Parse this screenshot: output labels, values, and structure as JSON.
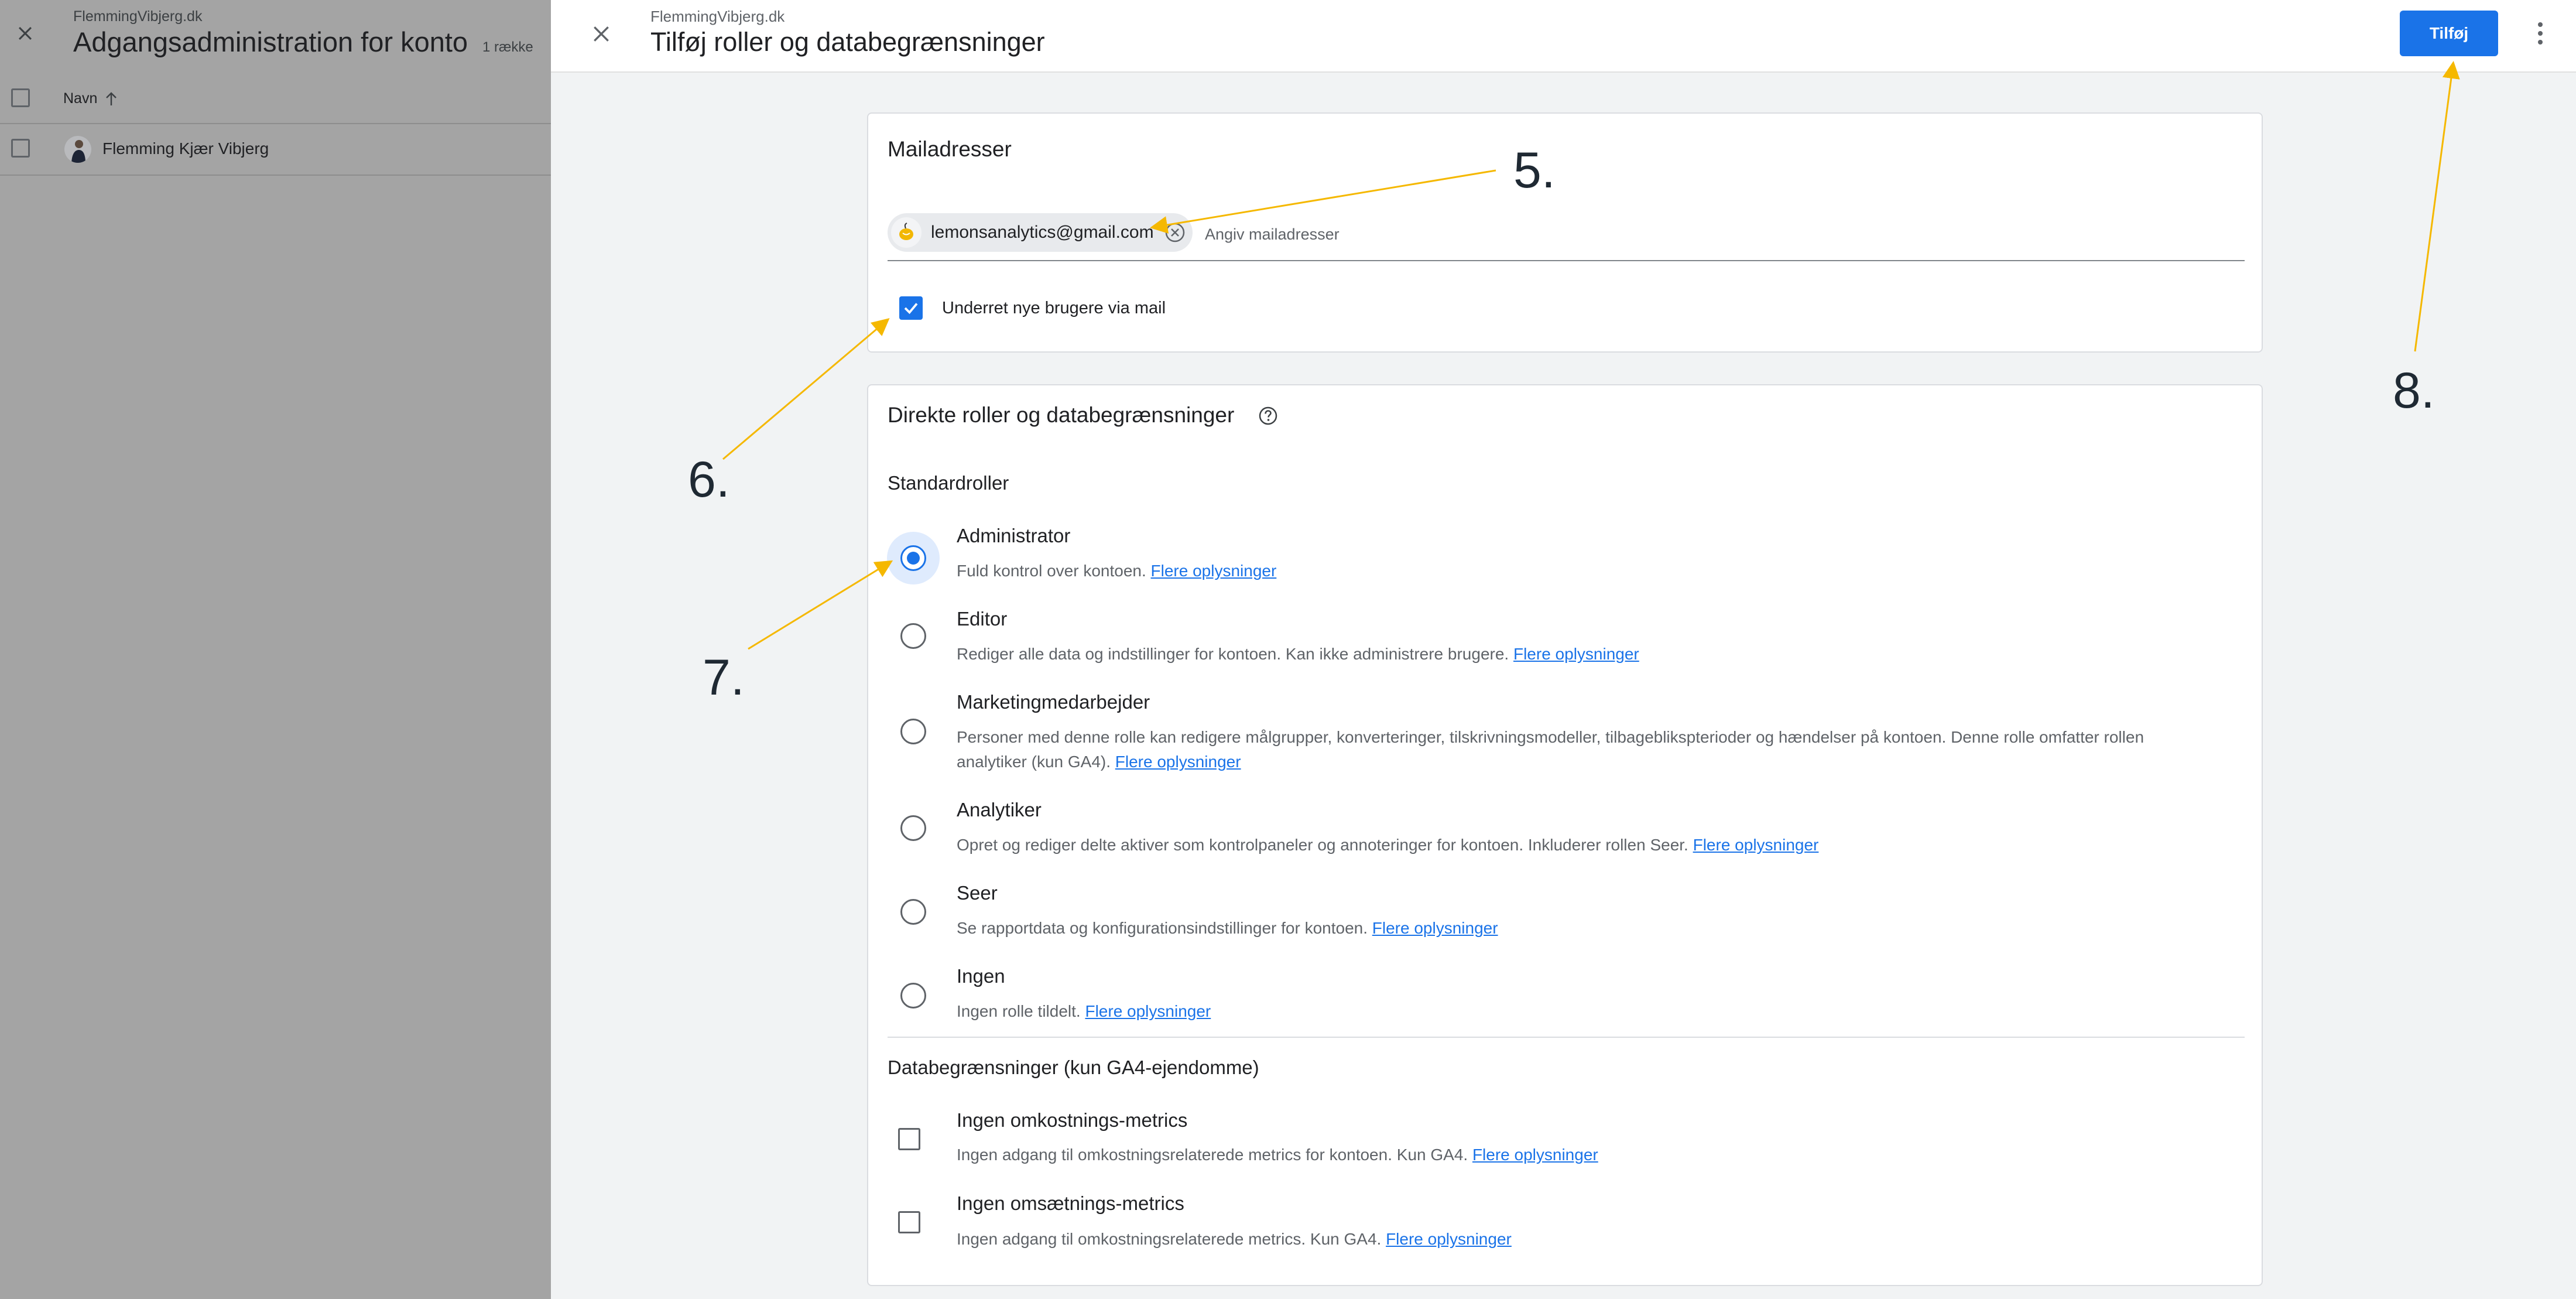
{
  "background_page": {
    "subtitle": "FlemmingVibjerg.dk",
    "title": "Adgangsadministration for konto",
    "row_count": "1 række",
    "column_name": "Navn",
    "user_name": "Flemming Kjær Vibjerg"
  },
  "panel": {
    "subtitle": "FlemmingVibjerg.dk",
    "title": "Tilføj roller og databegrænsninger",
    "add_button": "Tilføj"
  },
  "email_card": {
    "title": "Mailadresser",
    "chip_email": "lemonsanalytics@gmail.com",
    "input_placeholder": "Angiv mailadresser",
    "notify_label": "Underret nye brugere via mail",
    "notify_checked": true
  },
  "roles_card": {
    "title": "Direkte roller og databegrænsninger",
    "standard_roles_title": "Standardroller",
    "roles": [
      {
        "title": "Administrator",
        "description": "Fuld kontrol over kontoen.",
        "link": "Flere oplysninger",
        "selected": true
      },
      {
        "title": "Editor",
        "description": "Rediger alle data og indstillinger for kontoen. Kan ikke administrere brugere.",
        "link": "Flere oplysninger",
        "selected": false
      },
      {
        "title": "Marketingmedarbejder",
        "description": "Personer med denne rolle kan redigere målgrupper, konverteringer, tilskrivningsmodeller, tilbageblikspterioder og hændelser på kontoen. Denne rolle omfatter rollen analytiker (kun GA4).",
        "link": "Flere oplysninger",
        "selected": false
      },
      {
        "title": "Analytiker",
        "description": "Opret og rediger delte aktiver som kontrolpaneler og annoteringer for kontoen. Inkluderer rollen Seer.",
        "link": "Flere oplysninger",
        "selected": false
      },
      {
        "title": "Seer",
        "description": "Se rapportdata og konfigurationsindstillinger for kontoen.",
        "link": "Flere oplysninger",
        "selected": false
      },
      {
        "title": "Ingen",
        "description": "Ingen rolle tildelt.",
        "link": "Flere oplysninger",
        "selected": false
      }
    ],
    "data_restrictions_title": "Databegrænsninger (kun GA4-ejendomme)",
    "restrictions": [
      {
        "title": "Ingen omkostnings-metrics",
        "description": "Ingen adgang til omkostningsrelaterede metrics for kontoen. Kun GA4.",
        "link": "Flere oplysninger",
        "checked": false
      },
      {
        "title": "Ingen omsætnings-metrics",
        "description": "Ingen adgang til omkostningsrelaterede metrics. Kun GA4.",
        "link": "Flere oplysninger",
        "checked": false
      }
    ]
  },
  "annotations": {
    "step5": "5.",
    "step6": "6.",
    "step7": "7.",
    "step8": "8."
  },
  "colors": {
    "accent": "#1a73e8",
    "annotation_arrow": "#f5b800",
    "dim_overlay": "#a4a4a4"
  }
}
